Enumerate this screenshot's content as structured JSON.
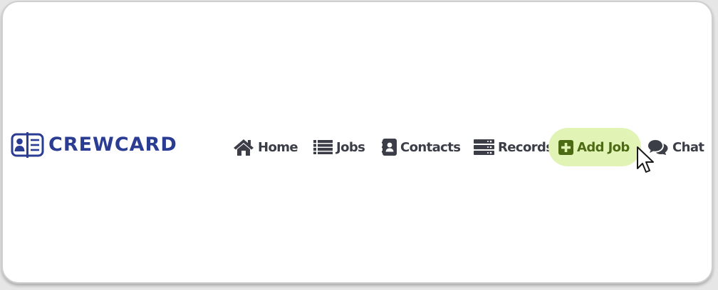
{
  "brand": {
    "name": "CREWCARD",
    "color": "#2b3c93"
  },
  "nav": {
    "items": [
      {
        "label": "Home",
        "icon": "home-icon"
      },
      {
        "label": "Jobs",
        "icon": "list-icon"
      },
      {
        "label": "Contacts",
        "icon": "contact-book-icon"
      },
      {
        "label": "Records",
        "icon": "server-icon"
      },
      {
        "label": "Add Job",
        "icon": "plus-square-icon",
        "active": true
      },
      {
        "label": "Chat",
        "icon": "chat-bubbles-icon"
      }
    ],
    "active_bg": "#e2f3b6",
    "active_fg": "#4d6b14",
    "text_color": "#3b3d47"
  }
}
